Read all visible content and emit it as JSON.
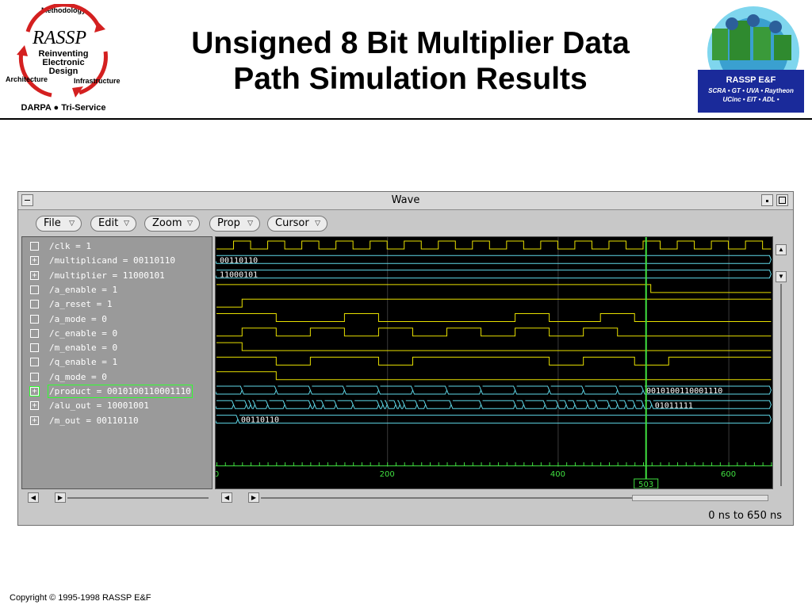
{
  "slide": {
    "title_line1": "Unsigned 8 Bit Multiplier Data",
    "title_line2": "Path Simulation Results",
    "copyright": "Copyright © 1995-1998 RASSP E&F"
  },
  "logo_left": {
    "top_label": "Methodology",
    "brand": "RASSP",
    "line1": "Reinventing",
    "line2": "Electronic",
    "line3": "Design",
    "left_label": "Architecture",
    "right_label": "Infrastructure",
    "bottom_label": "DARPA ● Tri-Service"
  },
  "logo_right": {
    "title": "RASSP E&F",
    "line1": "SCRA • GT • UVA • Raytheon",
    "line2": "UCinc • EIT • ADL •"
  },
  "window": {
    "title": "Wave",
    "menus": [
      "File",
      "Edit",
      "Zoom",
      "Prop",
      "Cursor"
    ],
    "status_range": "0 ns to 650 ns"
  },
  "signals": [
    {
      "expand": "",
      "label": "/clk = 1"
    },
    {
      "expand": "+",
      "label": "/multiplicand = 00110110"
    },
    {
      "expand": "+",
      "label": "/multiplier = 11000101"
    },
    {
      "expand": "",
      "label": "/a_enable = 1"
    },
    {
      "expand": "",
      "label": "/a_reset = 1"
    },
    {
      "expand": "",
      "label": "/a_mode = 0"
    },
    {
      "expand": "",
      "label": "/c_enable = 0"
    },
    {
      "expand": "",
      "label": "/m_enable = 0"
    },
    {
      "expand": "",
      "label": "/q_enable = 1"
    },
    {
      "expand": "",
      "label": "/q_mode = 0"
    },
    {
      "expand": "+",
      "label": "/product = 0010100110001110",
      "selected": true
    },
    {
      "expand": "+",
      "label": "/alu_out = 10001001"
    },
    {
      "expand": "+",
      "label": "/m_out = 00110110"
    }
  ],
  "waveform": {
    "time_start_ns": 0,
    "time_end_ns": 650,
    "axis_ticks": [
      0,
      200,
      400,
      600
    ],
    "cursor_ns": 503,
    "cursor_label": "503",
    "bus_values": {
      "multiplicand": "00110110",
      "multiplier": "11000101",
      "product_final": "0010100110001110",
      "alu_out_final": "01011111",
      "m_out": "00110110"
    },
    "colors": {
      "background": "#000000",
      "digital": "#e8e000",
      "bus": "#5fd8e8",
      "cursor": "#40e040",
      "axis": "#40e040",
      "grid": "#3a3a3a"
    }
  }
}
